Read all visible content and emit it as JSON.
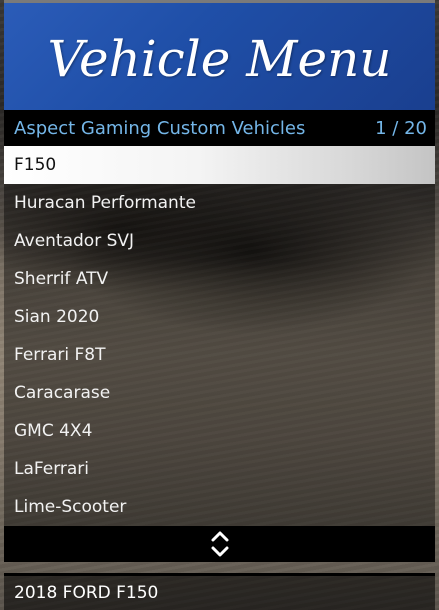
{
  "menu": {
    "title": "Vehicle Menu",
    "subtitle": "Aspect Gaming Custom Vehicles",
    "counter": "1 / 20",
    "items": [
      "F150",
      "Huracan Performante",
      "Aventador SVJ",
      "Sherrif ATV",
      "Sian 2020",
      "Ferrari F8T",
      "Caracarase",
      "GMC 4X4",
      "LaFerrari",
      "Lime-Scooter"
    ],
    "selected_index": 0,
    "scroll_icon": "up-down-chevron-icon",
    "description": "2018 FORD F150"
  },
  "colors": {
    "banner": "#1f4fa8",
    "subtitle_text": "#74b6e8",
    "selected_bg": "#ffffff"
  }
}
